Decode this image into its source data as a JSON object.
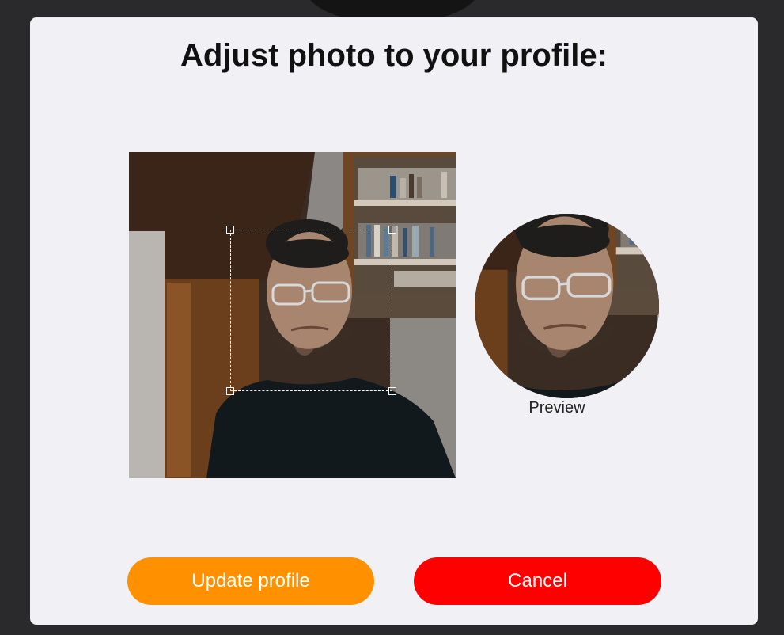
{
  "dialog": {
    "title": "Adjust photo to your profile:"
  },
  "preview": {
    "label": "Preview"
  },
  "buttons": {
    "update_label": "Update profile",
    "cancel_label": "Cancel"
  },
  "colors": {
    "update_button": "#ff9000",
    "cancel_button": "#ff0000",
    "modal_background": "#f0f0f5",
    "page_background": "#2a2a2c"
  }
}
